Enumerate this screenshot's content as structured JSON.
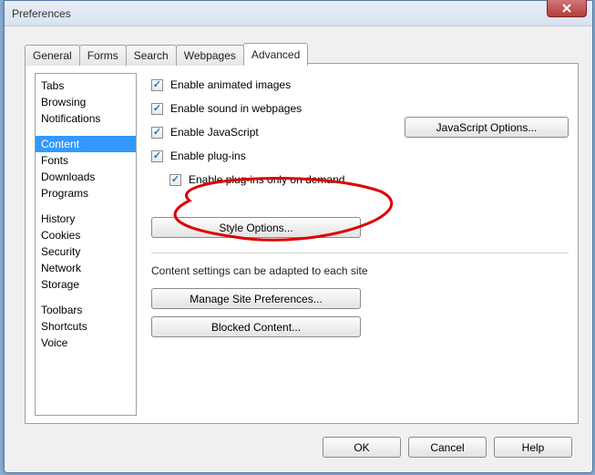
{
  "window": {
    "title": "Preferences"
  },
  "tabs": [
    {
      "label": "General"
    },
    {
      "label": "Forms"
    },
    {
      "label": "Search"
    },
    {
      "label": "Webpages"
    },
    {
      "label": "Advanced"
    }
  ],
  "sidebar": {
    "groups": [
      [
        "Tabs",
        "Browsing",
        "Notifications"
      ],
      [
        "Content",
        "Fonts",
        "Downloads",
        "Programs"
      ],
      [
        "History",
        "Cookies",
        "Security",
        "Network",
        "Storage"
      ],
      [
        "Toolbars",
        "Shortcuts",
        "Voice"
      ]
    ],
    "selected": "Content"
  },
  "content": {
    "cb_animated": "Enable animated images",
    "cb_sound": "Enable sound in webpages",
    "cb_js": "Enable JavaScript",
    "btn_js": "JavaScript Options...",
    "cb_plugins": "Enable plug-ins",
    "cb_plugins_demand": "Enable plug-ins only on demand",
    "btn_style": "Style Options...",
    "note": "Content settings can be adapted to each site",
    "btn_site_prefs": "Manage Site Preferences...",
    "btn_blocked": "Blocked Content..."
  },
  "footer": {
    "ok": "OK",
    "cancel": "Cancel",
    "help": "Help"
  }
}
